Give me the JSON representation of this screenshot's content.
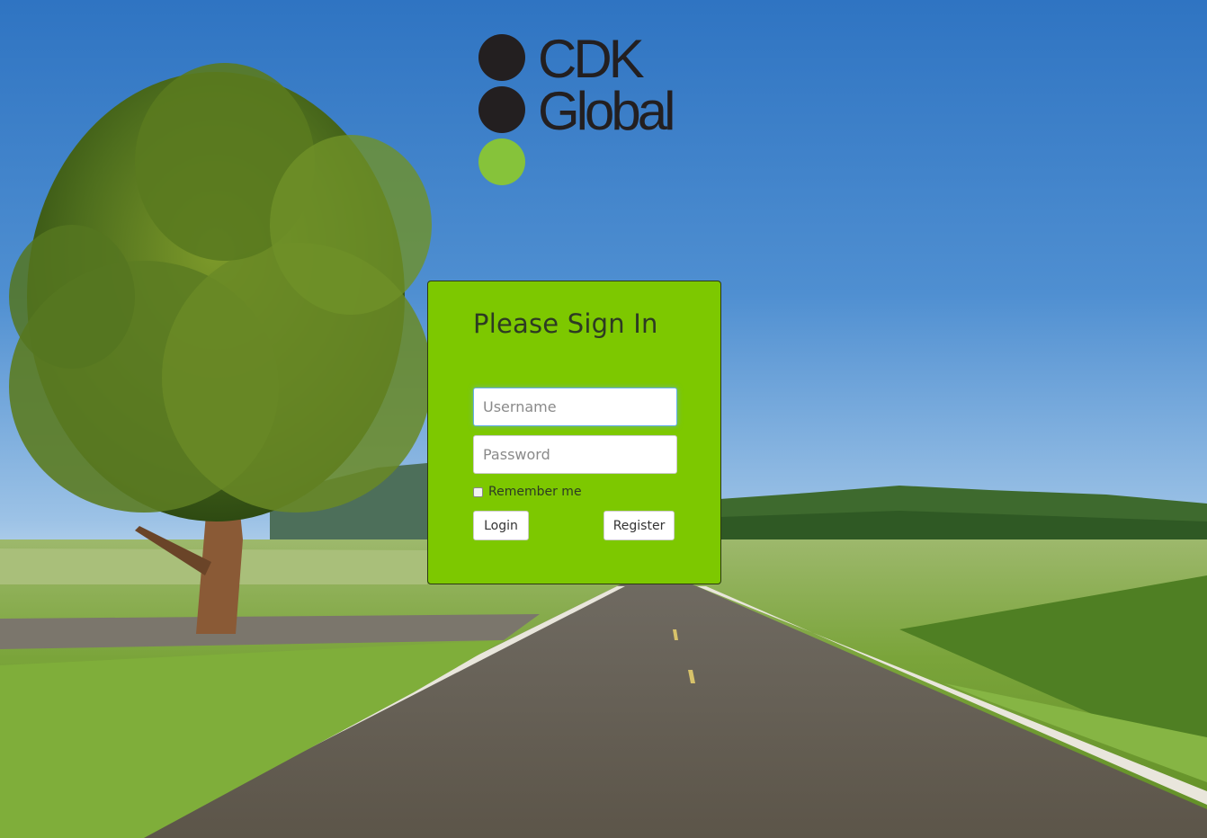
{
  "logo": {
    "line1": "CDK",
    "line2": "Global",
    "colors": {
      "dark": "#231f20",
      "green": "#86c33a"
    }
  },
  "signin": {
    "title": "Please Sign In",
    "username_placeholder": "Username",
    "password_placeholder": "Password",
    "remember_label": "Remember me",
    "remember_checked": false,
    "login_label": "Login",
    "register_label": "Register",
    "panel_color": "#7dc800"
  },
  "background": {
    "description_icon": "landscape-photo"
  }
}
